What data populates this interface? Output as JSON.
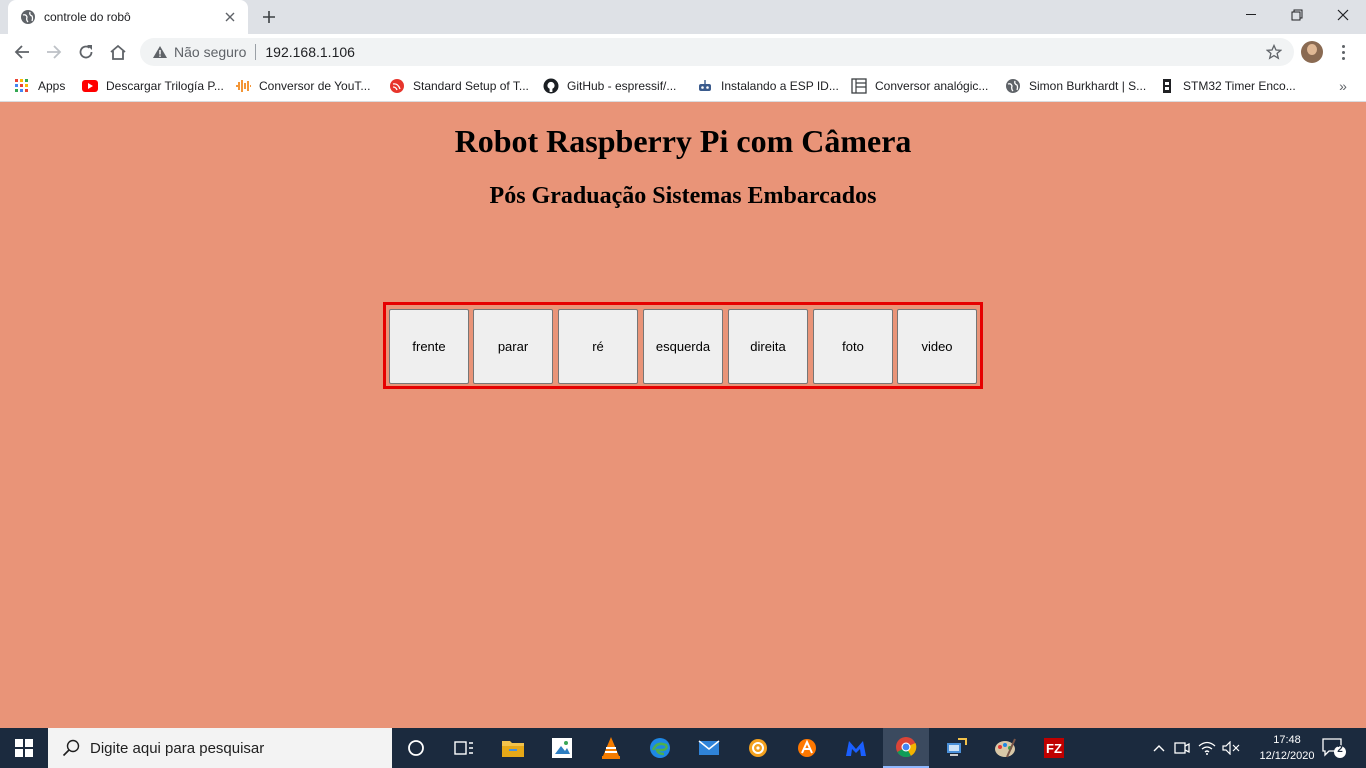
{
  "browser": {
    "tab_title": "controle do robô",
    "new_tab": "+",
    "security_label": "Não seguro",
    "url": "192.168.1.106"
  },
  "bookmarks": [
    {
      "label": "Apps",
      "icon": "apps-grid-icon"
    },
    {
      "label": "Descargar Trilogía P...",
      "icon": "youtube-icon"
    },
    {
      "label": "Conversor de YouT...",
      "icon": "audio-wave-icon"
    },
    {
      "label": "Standard Setup of T...",
      "icon": "espressif-icon"
    },
    {
      "label": "GitHub - espressif/...",
      "icon": "github-icon"
    },
    {
      "label": "Instalando a ESP ID...",
      "icon": "robot-icon"
    },
    {
      "label": "Conversor analógic...",
      "icon": "page-icon"
    },
    {
      "label": "Simon Burkhardt | S...",
      "icon": "globe-icon"
    },
    {
      "label": "STM32 Timer Enco...",
      "icon": "encoder-icon"
    }
  ],
  "page": {
    "title": "Robot Raspberry Pi com Câmera",
    "subtitle": "Pós Graduação Sistemas Embarcados",
    "buttons": [
      "frente",
      "parar",
      "ré",
      "esquerda",
      "direita",
      "foto",
      "video"
    ]
  },
  "taskbar": {
    "search_placeholder": "Digite aqui para pesquisar",
    "time": "17:48",
    "date": "12/12/2020",
    "notification_count": "2"
  },
  "colors": {
    "page_background": "#e99478",
    "button_group_border": "#e60000",
    "taskbar": "#1b2a3e"
  }
}
